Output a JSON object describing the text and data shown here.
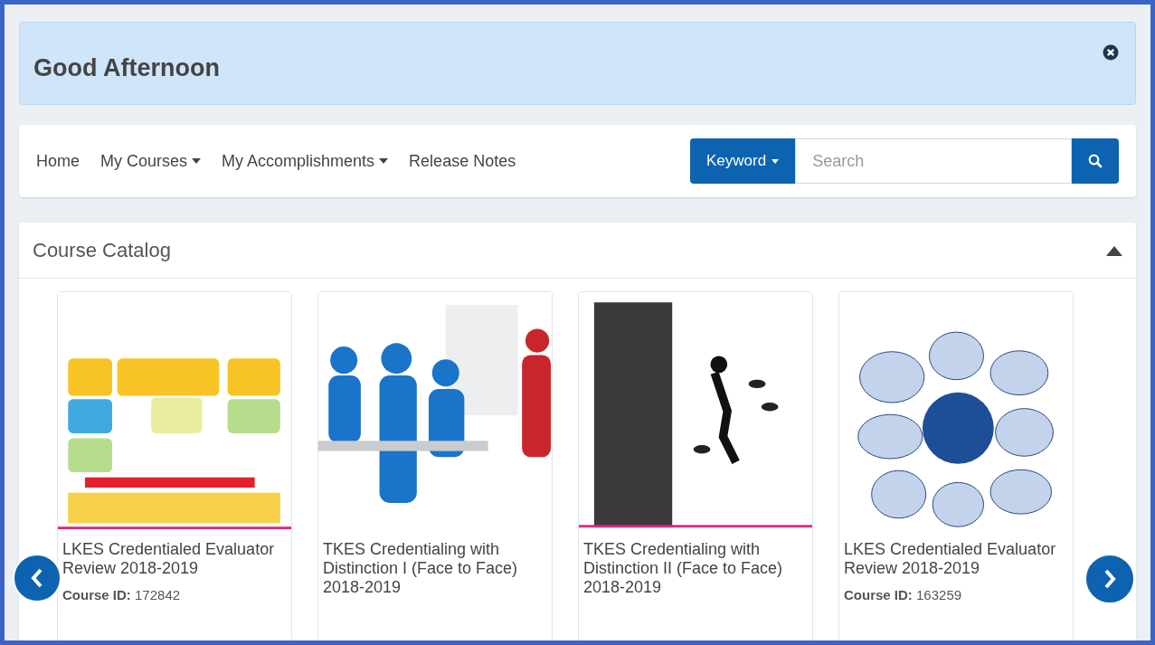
{
  "greeting": {
    "title": "Good Afternoon"
  },
  "nav": {
    "items": [
      {
        "label": "Home",
        "dropdown": false
      },
      {
        "label": "My Courses",
        "dropdown": true
      },
      {
        "label": "My Accomplishments",
        "dropdown": true
      },
      {
        "label": "Release Notes",
        "dropdown": false
      }
    ],
    "search": {
      "filter": "Keyword",
      "placeholder": "Search"
    }
  },
  "catalog": {
    "title": "Course Catalog",
    "expanded": true,
    "courses": [
      {
        "title": "LKES Credentialed Evaluator Review 2018-2019",
        "id_label": "Course ID:",
        "id": "172842"
      },
      {
        "title": "TKES Credentialing with Distinction I (Face to Face) 2018-2019"
      },
      {
        "title": "TKES Credentialing with Distinction II (Face to Face) 2018-2019"
      },
      {
        "title": "LKES Credentialed Evaluator Review 2018-2019",
        "id_label": "Course ID:",
        "id": "163259"
      }
    ]
  }
}
